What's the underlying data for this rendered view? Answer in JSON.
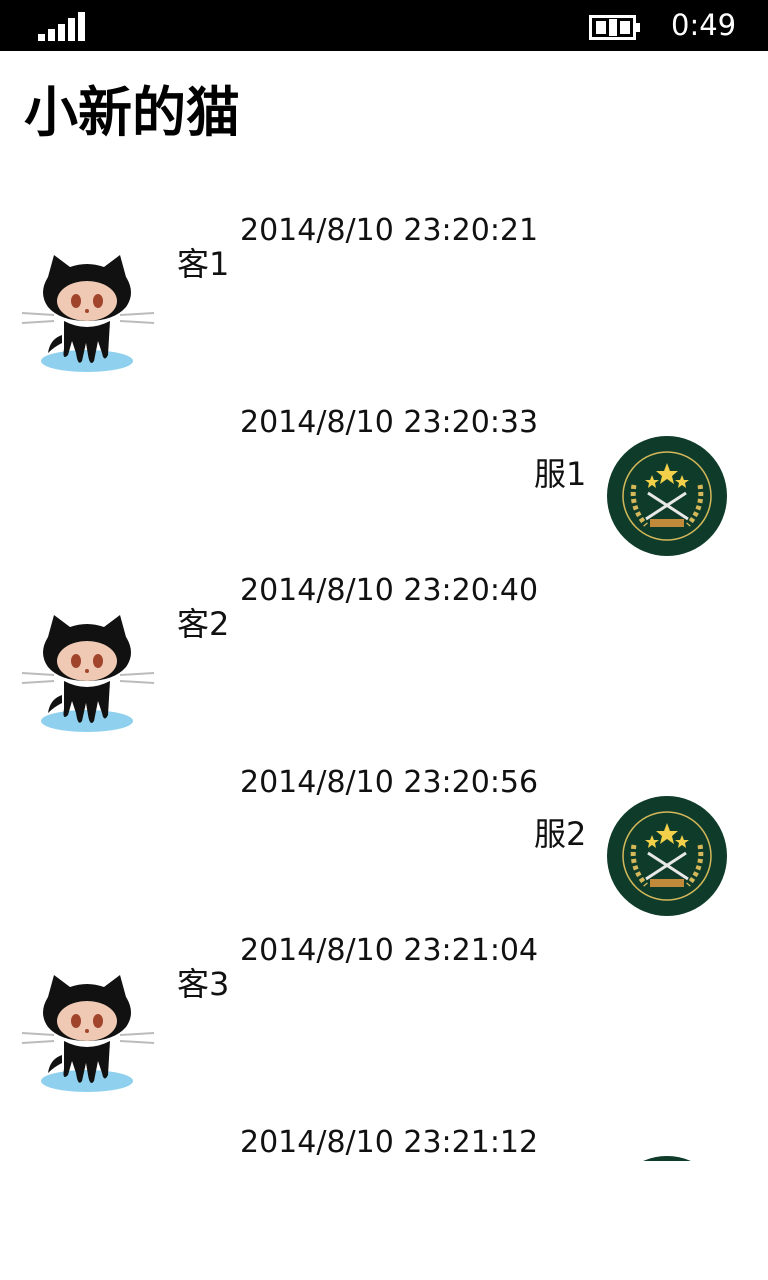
{
  "status_bar": {
    "time": "0:49",
    "signal_icon": "signal-strength-icon",
    "battery_icon": "battery-charging-icon"
  },
  "page": {
    "title": "小新的猫"
  },
  "messages": [
    {
      "time": "2014/8/10 23:20:21",
      "text": "客1",
      "sender": "client",
      "avatar_icon": "octocat-avatar-icon"
    },
    {
      "time": "2014/8/10 23:20:33",
      "text": "服1",
      "sender": "server",
      "avatar_icon": "university-emblem-avatar-icon"
    },
    {
      "time": "2014/8/10 23:20:40",
      "text": "客2",
      "sender": "client",
      "avatar_icon": "octocat-avatar-icon"
    },
    {
      "time": "2014/8/10 23:20:56",
      "text": "服2",
      "sender": "server",
      "avatar_icon": "university-emblem-avatar-icon"
    },
    {
      "time": "2014/8/10 23:21:04",
      "text": "客3",
      "sender": "client",
      "avatar_icon": "octocat-avatar-icon"
    },
    {
      "time": "2014/8/10 23:21:12",
      "text": "",
      "sender": "server",
      "avatar_icon": "university-emblem-avatar-icon"
    }
  ],
  "colors": {
    "status_bar_bg": "#000000",
    "page_bg": "#ffffff",
    "emblem_green": "#0f3b2a",
    "emblem_gold": "#d4b85a",
    "octocat_water": "#8fd0ee"
  }
}
